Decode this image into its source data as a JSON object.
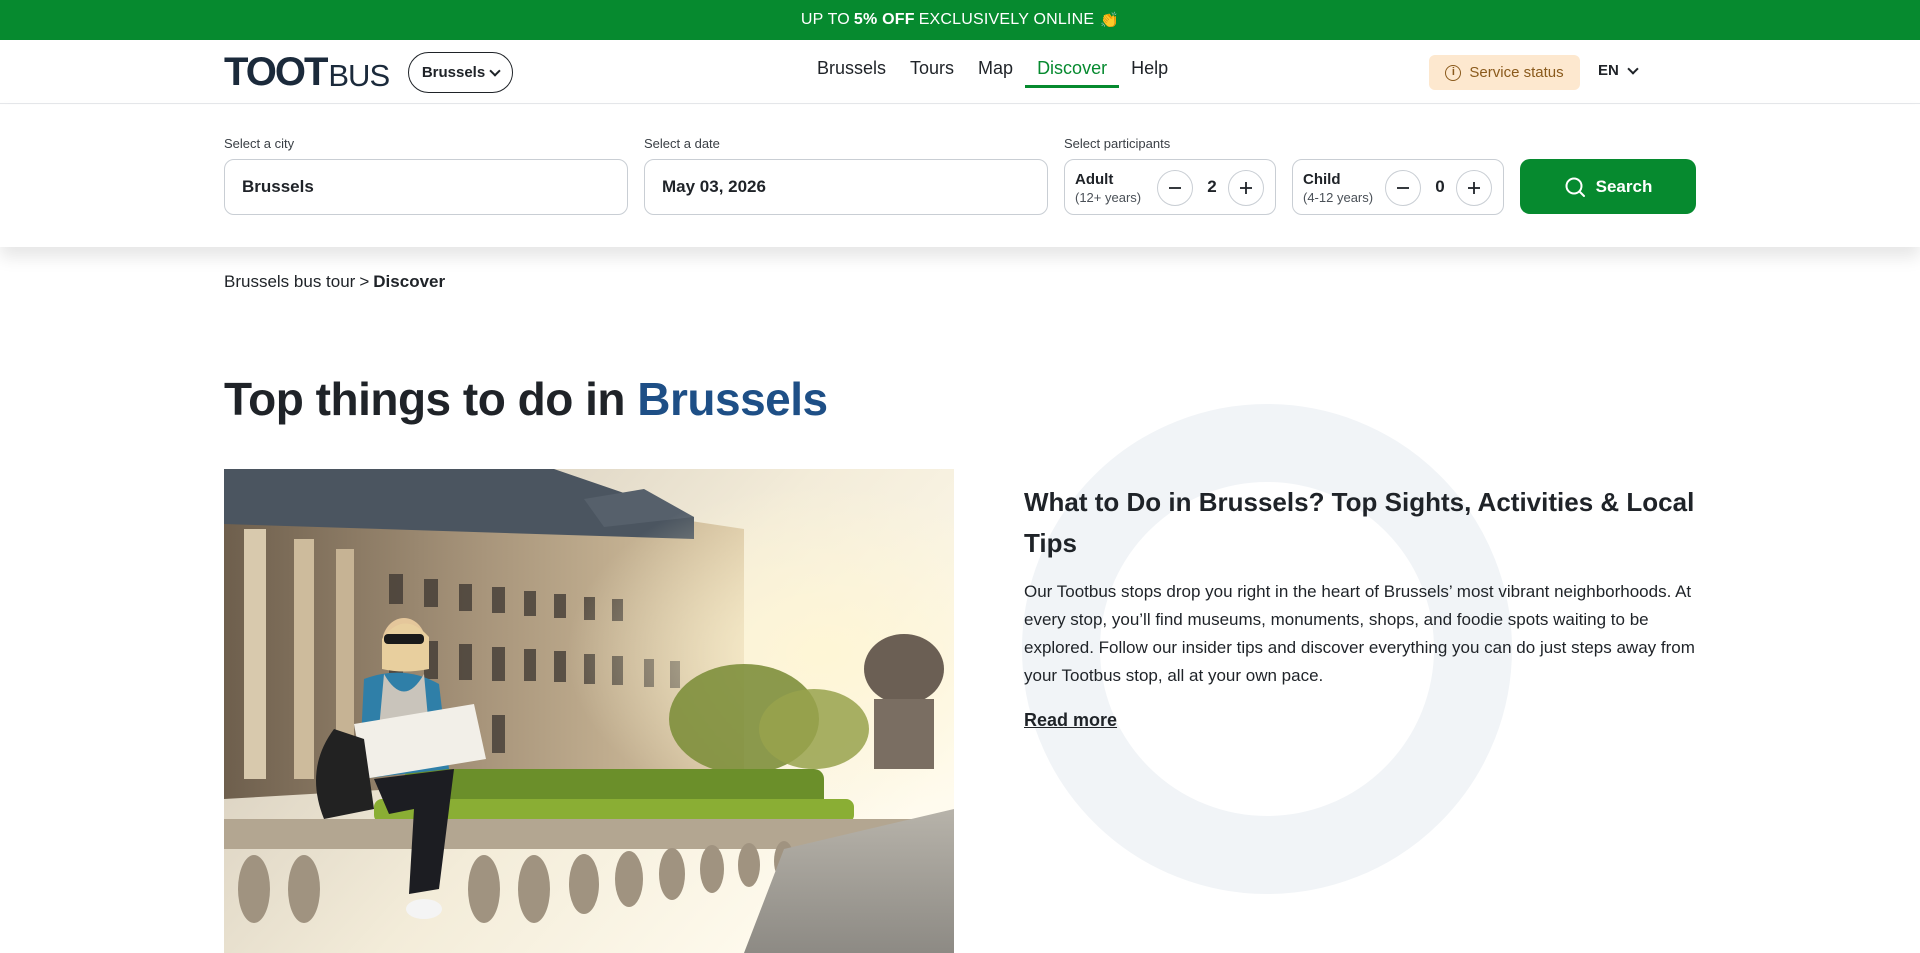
{
  "promo": {
    "prefix": "UP TO",
    "highlight": "5% OFF",
    "suffix": "EXCLUSIVELY ONLINE",
    "emoji": "👏"
  },
  "header": {
    "logo_main": "TOOT",
    "logo_sub": "BUS",
    "city_selector": "Brussels",
    "nav": [
      "Brussels",
      "Tours",
      "Map",
      "Discover",
      "Help"
    ],
    "active_nav": "Discover",
    "service_status": "Service status",
    "language": "EN"
  },
  "search": {
    "city_label": "Select a city",
    "city_value": "Brussels",
    "date_label": "Select a date",
    "date_value": "May 03, 2026",
    "participants_label": "Select participants",
    "adult_label": "Adult",
    "adult_sub": "(12+ years)",
    "adult_count": "2",
    "child_label": "Child",
    "child_sub": "(4-12 years)",
    "child_count": "0",
    "button": "Search"
  },
  "breadcrumb": {
    "parent": "Brussels bus tour",
    "separator": ">",
    "current": "Discover"
  },
  "page": {
    "title_prefix": "Top things to do in",
    "title_city": "Brussels",
    "heading": "What to Do in Brussels? Top Sights, Activities & Local Tips",
    "body": "Our Tootbus stops drop you right in the heart of Brussels’ most vibrant neighborhoods. At every stop, you’ll find museums, monuments, shops, and foodie spots waiting to be explored. Follow our insider tips and discover everything you can do just steps away from your Tootbus stop, all at your own pace.",
    "read_more": "Read more"
  },
  "colors": {
    "brand_green": "#068a2f",
    "city_blue": "#1e4f86",
    "service_bg": "#fde8cf"
  }
}
